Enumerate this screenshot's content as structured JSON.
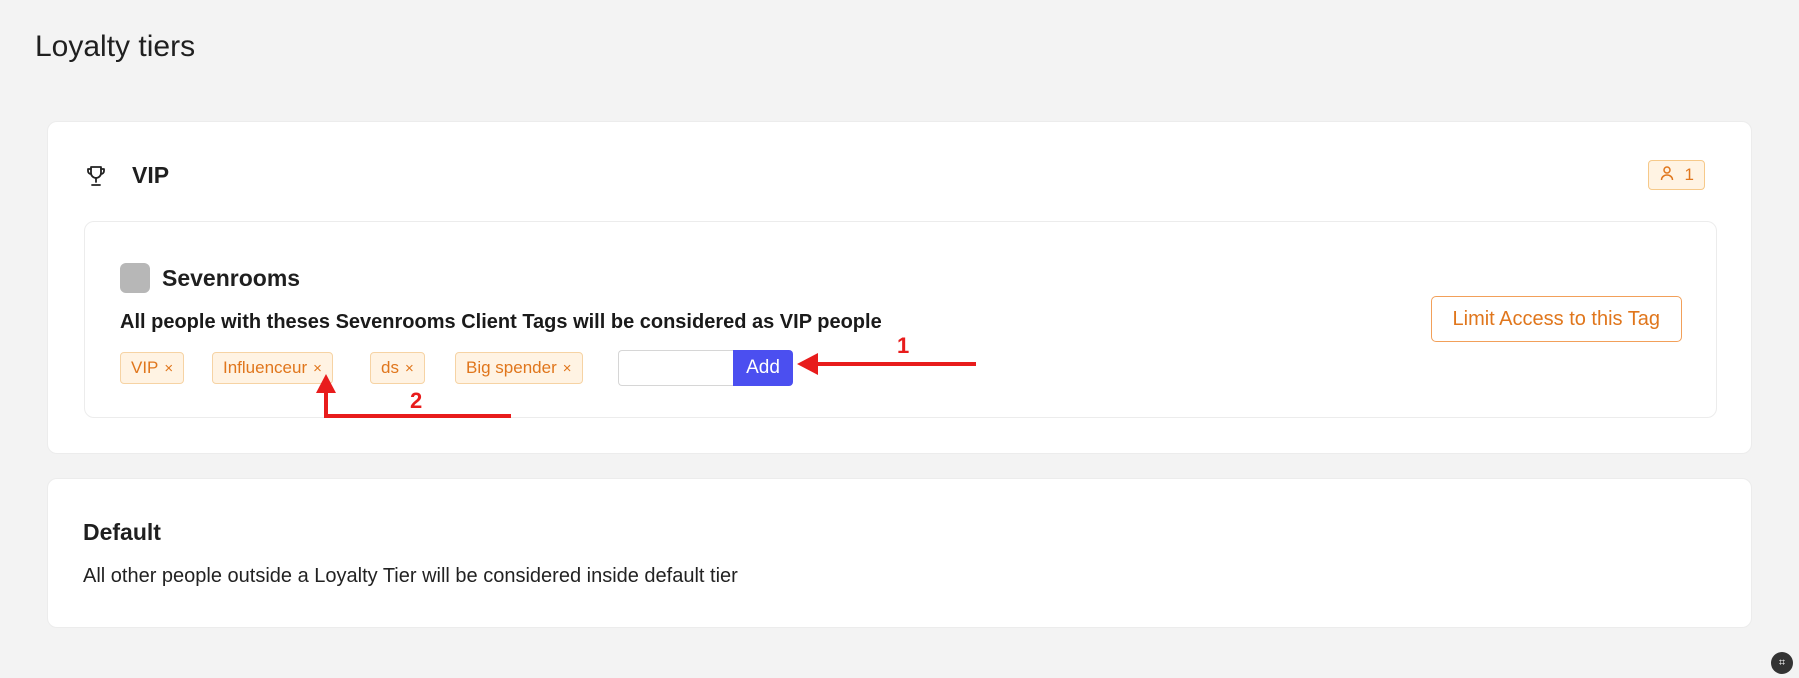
{
  "page": {
    "title": "Loyalty tiers"
  },
  "vip_tier": {
    "name": "VIP",
    "people_count": "1",
    "integration": {
      "name": "Sevenrooms",
      "description": "All people with theses Sevenrooms Client Tags will be considered as VIP people",
      "tags": [
        {
          "label": "VIP",
          "remove": "×"
        },
        {
          "label": "Influenceur",
          "remove": "×"
        },
        {
          "label": "ds",
          "remove": "×"
        },
        {
          "label": "Big spender",
          "remove": "×"
        }
      ],
      "input_value": "",
      "add_label": "Add",
      "limit_label": "Limit Access to this Tag"
    }
  },
  "default_tier": {
    "name": "Default",
    "description": "All other people outside a Loyalty Tier will be considered inside default tier"
  },
  "annotations": {
    "label_1": "1",
    "label_2": "2",
    "color": "#e81c1c"
  },
  "colors": {
    "accent_orange": "#e0761c",
    "add_button": "#4b4ff0",
    "tag_bg": "#fff3e3"
  },
  "icons": {
    "tier": "trophy-icon",
    "people": "user-icon"
  }
}
